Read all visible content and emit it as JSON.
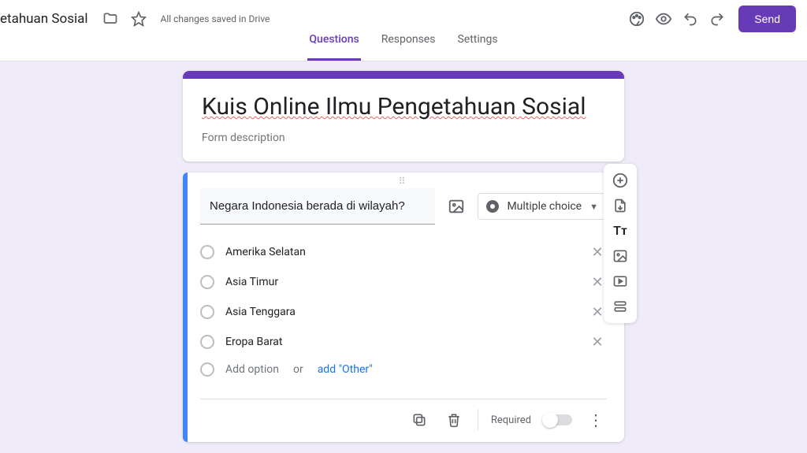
{
  "header": {
    "doc_title_fragment": "etahuan Sosial",
    "saved_msg": "All changes saved in Drive",
    "send_label": "Send"
  },
  "tabs": {
    "questions": "Questions",
    "responses": "Responses",
    "settings": "Settings"
  },
  "form": {
    "title": "Kuis Online Ilmu Pengetahuan Sosial",
    "description": "Form description"
  },
  "question": {
    "text": "Negara Indonesia berada di wilayah?",
    "type_label": "Multiple choice",
    "options": [
      "Amerika Selatan",
      "Asia Timur",
      "Asia Tenggara",
      "Eropa Barat"
    ],
    "add_option": "Add option",
    "or": "or",
    "add_other": "add \"Other\"",
    "required_label": "Required"
  }
}
